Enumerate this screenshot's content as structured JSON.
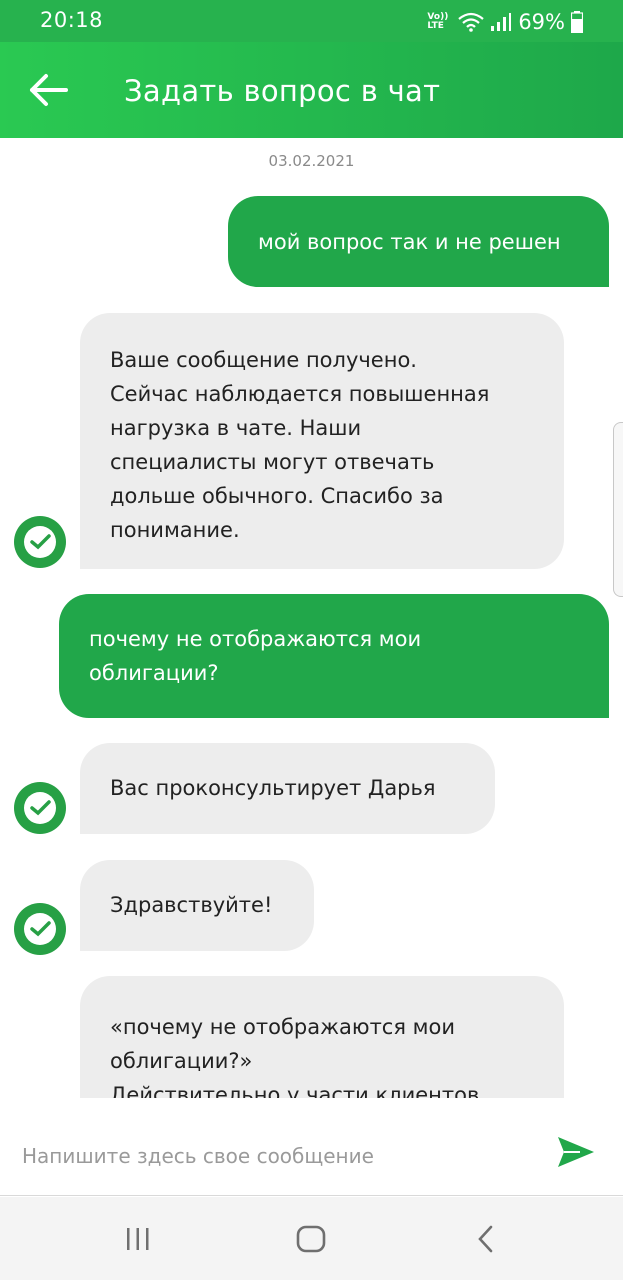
{
  "status_bar": {
    "time": "20:18",
    "volte_top": "Vo))",
    "volte_bottom": "LTE",
    "battery": "69%",
    "icons": [
      "volte-icon",
      "wifi-icon",
      "signal-icon",
      "battery-icon"
    ]
  },
  "header": {
    "title": "Задать вопрос в чат",
    "back_icon": "arrow-left-icon"
  },
  "chat": {
    "date": "03.02.2021",
    "messages": [
      {
        "direction": "outgoing",
        "text": "мой вопрос так и не решен"
      },
      {
        "direction": "incoming",
        "text": "Ваше сообщение получено.\nСейчас наблюдается повышенная\nнагрузка в чате. Наши\nспециалисты могут отвечать\nдольше обычного. Спасибо за\nпонимание."
      },
      {
        "direction": "outgoing",
        "text": "почему не отображаются мои\nоблигации?"
      },
      {
        "direction": "incoming",
        "text": "Вас проконсультирует Дарья"
      },
      {
        "direction": "incoming",
        "text": "Здравствуйте!"
      },
      {
        "direction": "incoming",
        "text": "«почему не отображаются мои\nоблигации?»\nДействительно у части клиентов"
      }
    ],
    "avatar_icon": "sber-logo-icon"
  },
  "composer": {
    "placeholder": "Напишите здесь свое сообщение",
    "send_icon": "send-icon"
  },
  "nav_bar": {
    "icons": [
      "recent-apps-icon",
      "home-icon",
      "back-icon"
    ]
  },
  "colors": {
    "brand_green": "#21a74a",
    "header_green": "#27b24e",
    "incoming_bubble": "#ededed"
  }
}
